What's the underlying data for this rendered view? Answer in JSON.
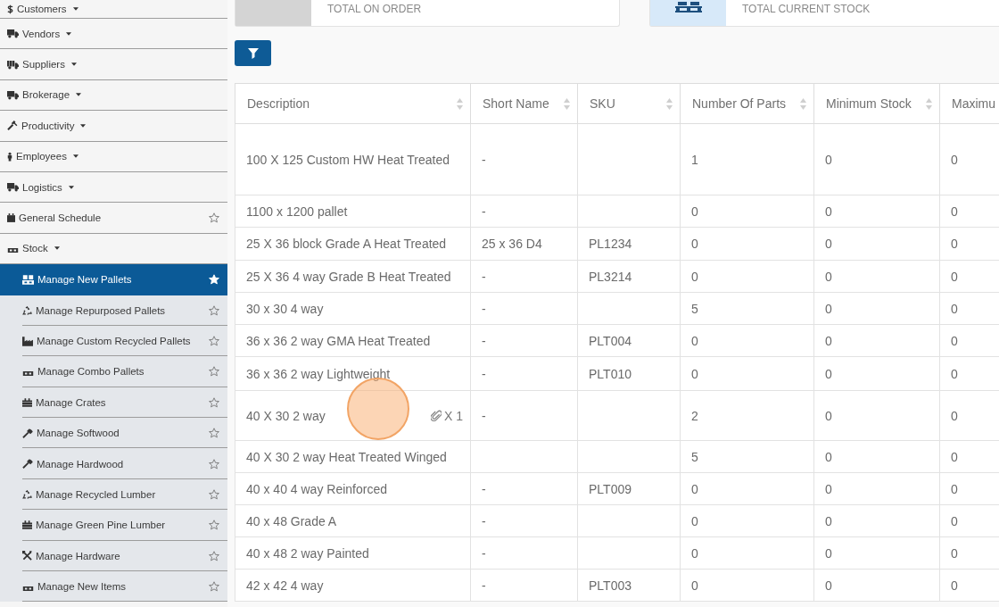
{
  "sidebar": {
    "items": [
      {
        "label": "Customers",
        "kind": "menu"
      },
      {
        "label": "Vendors",
        "kind": "menu"
      },
      {
        "label": "Suppliers",
        "kind": "menu"
      },
      {
        "label": "Brokerage",
        "kind": "menu"
      },
      {
        "label": "Productivity",
        "kind": "menu"
      },
      {
        "label": "Employees",
        "kind": "menu"
      },
      {
        "label": "Logistics",
        "kind": "menu"
      },
      {
        "label": "General Schedule",
        "kind": "link",
        "favorite": false
      },
      {
        "label": "Stock",
        "kind": "menu",
        "children": [
          {
            "label": "Manage New Pallets",
            "selected": true,
            "favorite": true
          },
          {
            "label": "Manage Repurposed Pallets",
            "selected": false,
            "favorite": false
          },
          {
            "label": "Manage Custom Recycled Pallets",
            "selected": false,
            "favorite": false
          },
          {
            "label": "Manage Combo Pallets",
            "selected": false,
            "favorite": false
          },
          {
            "label": "Manage Crates",
            "selected": false,
            "favorite": false
          },
          {
            "label": "Manage Softwood",
            "selected": false,
            "favorite": false
          },
          {
            "label": "Manage Hardwood",
            "selected": false,
            "favorite": false
          },
          {
            "label": "Manage Recycled Lumber",
            "selected": false,
            "favorite": false
          },
          {
            "label": "Manage Green Pine Lumber",
            "selected": false,
            "favorite": false
          },
          {
            "label": "Manage Hardware",
            "selected": false,
            "favorite": false
          },
          {
            "label": "Manage New Items",
            "selected": false,
            "favorite": false
          }
        ]
      }
    ]
  },
  "stats": [
    {
      "label": "TOTAL ON ORDER",
      "color": "#d4d4d4"
    },
    {
      "label": "TOTAL CURRENT STOCK",
      "color": "#d7e9f9"
    }
  ],
  "table": {
    "columns": [
      {
        "label": "Description"
      },
      {
        "label": "Short Name"
      },
      {
        "label": "SKU"
      },
      {
        "label": "Number Of Parts"
      },
      {
        "label": "Minimum Stock"
      },
      {
        "label": "Maximu"
      }
    ],
    "rows": [
      {
        "cells": [
          "100 X 125 Custom HW Heat Treated",
          "-",
          null,
          "1",
          "0",
          "0"
        ]
      },
      {
        "cells": [
          "1100 x 1200 pallet",
          "-",
          null,
          "0",
          "0",
          "0"
        ]
      },
      {
        "cells": [
          "25 X 36 block Grade A Heat Treated",
          "25 x 36 D4",
          "PL1234",
          "0",
          "0",
          "0"
        ]
      },
      {
        "cells": [
          "25 X 36 4 way Grade B Heat Treated",
          "-",
          "PL3214",
          "0",
          "0",
          "0"
        ]
      },
      {
        "cells": [
          "30 x 30 4 way",
          "-",
          null,
          "5",
          "0",
          "0"
        ]
      },
      {
        "cells": [
          "36 x 36 2 way GMA Heat Treated",
          "-",
          "PLT004",
          "0",
          "0",
          "0"
        ]
      },
      {
        "cells": [
          "36 x 36 2 way Lightweight",
          "-",
          "PLT010",
          "0",
          "0",
          "0"
        ]
      },
      {
        "cells": [
          "40 X 30 2 way",
          "-",
          null,
          "2",
          "0",
          "0"
        ],
        "attachment": "X 1"
      },
      {
        "cells": [
          "40 X 30 2 way Heat Treated Winged",
          null,
          null,
          "5",
          "0",
          "0"
        ]
      },
      {
        "cells": [
          "40 x 40 4 way Reinforced",
          "-",
          "PLT009",
          "0",
          "0",
          "0"
        ]
      },
      {
        "cells": [
          "40 x 48 Grade A",
          "-",
          null,
          "0",
          "0",
          "0"
        ]
      },
      {
        "cells": [
          "40 x 48 2 way Painted",
          "-",
          null,
          "0",
          "0",
          "0"
        ]
      },
      {
        "cells": [
          "42 x 42 4 way",
          "-",
          "PLT003",
          "0",
          "0",
          "0"
        ]
      }
    ]
  }
}
